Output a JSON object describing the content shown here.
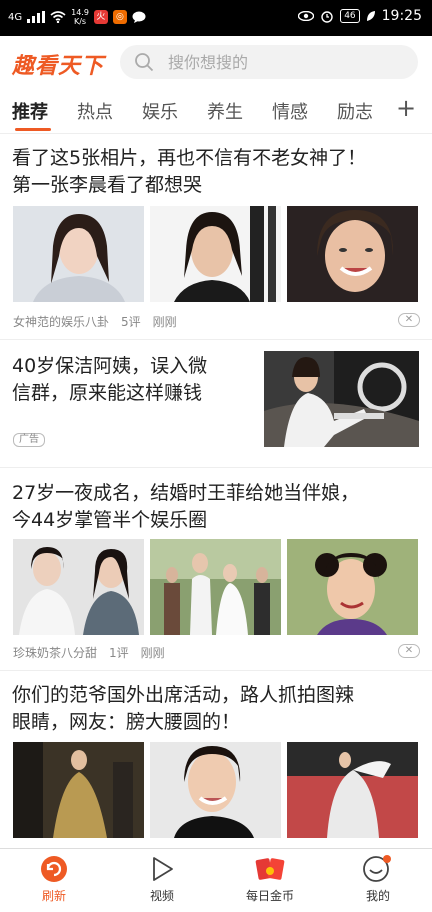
{
  "status_bar": {
    "signal": "4G",
    "speed_value": "14.9",
    "speed_unit": "K/s",
    "battery": "46",
    "time": "19:25"
  },
  "header": {
    "logo": "趣看天下",
    "search_placeholder": "搜你想搜的"
  },
  "tabs": [
    "推荐",
    "热点",
    "娱乐",
    "养生",
    "情感",
    "励志"
  ],
  "tab_more": "+",
  "articles": [
    {
      "title_line1": "看了这5张相片，再也不信有不老女神了！",
      "title_line2": "第一张李晨看了都想哭",
      "source": "女神范的娱乐八卦",
      "comments": "5评",
      "time": "刚刚"
    },
    {
      "title_line1": "40岁保洁阿姨，误入微",
      "title_line2": "信群，原来能这样赚钱",
      "ad_label": "广告"
    },
    {
      "title_line1": "27岁一夜成名，结婚时王菲给她当伴娘，",
      "title_line2": "今44岁掌管半个娱乐圈",
      "source": "珍珠奶茶八分甜",
      "comments": "1评",
      "time": "刚刚"
    },
    {
      "title_line1": "你们的范爷国外出席活动，路人抓拍图辣",
      "title_line2": "眼睛，网友：膀大腰圆的！"
    }
  ],
  "bottom_nav": [
    {
      "label": "刷新",
      "icon": "refresh-icon"
    },
    {
      "label": "视频",
      "icon": "play-icon"
    },
    {
      "label": "每日金币",
      "icon": "red-envelope-icon"
    },
    {
      "label": "我的",
      "icon": "profile-icon"
    }
  ],
  "colors": {
    "accent": "#ee5a24"
  }
}
